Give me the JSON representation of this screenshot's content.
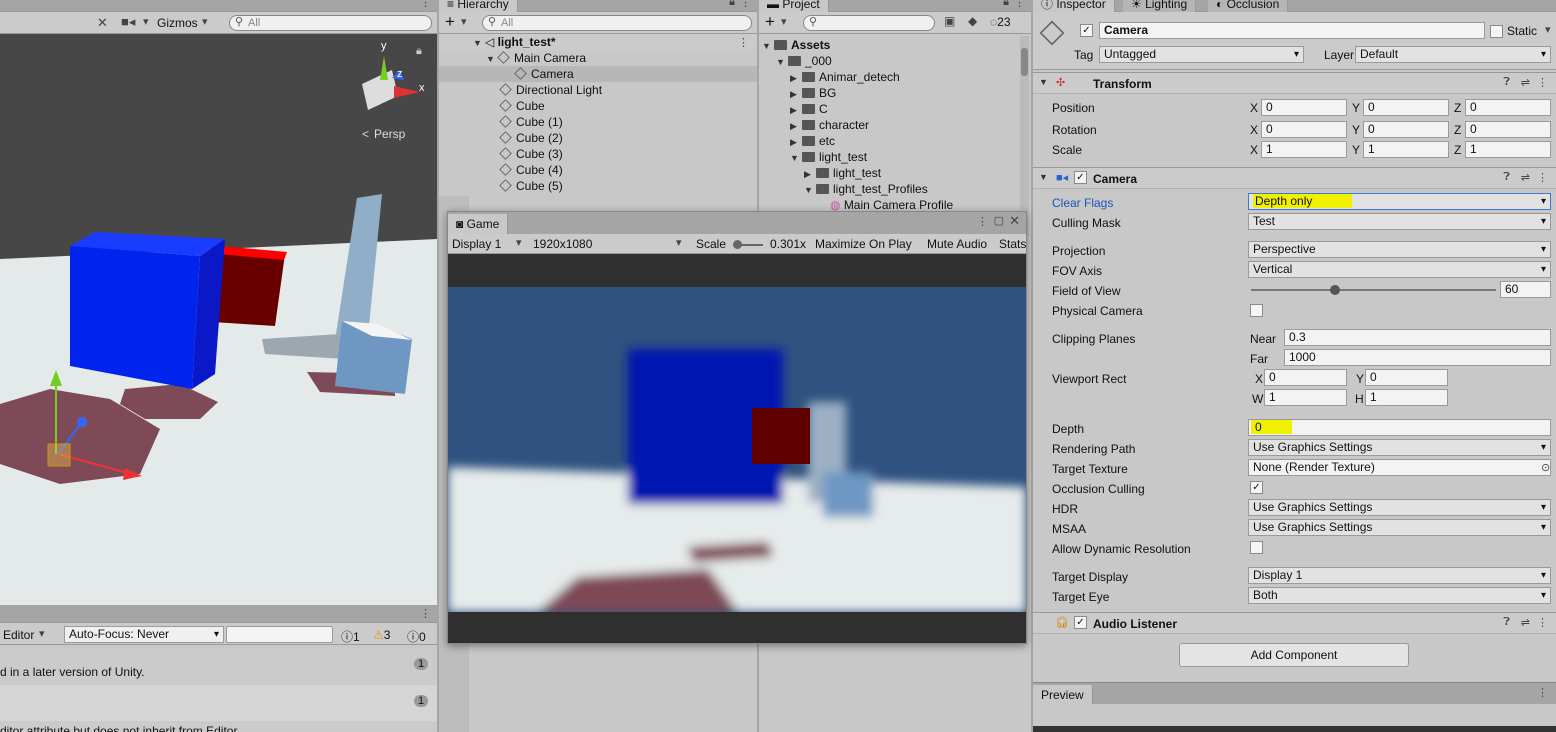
{
  "scene": {
    "toolbar": {
      "gizmos_label": "Gizmos",
      "search_placeholder": "All"
    },
    "view_mode": "Persp",
    "axes": {
      "x": "x",
      "y": "y",
      "z": "z"
    },
    "console": {
      "editor_label": "Editor",
      "autofocus_label": "Auto-Focus: Never",
      "counts": {
        "info": "1",
        "warn": "3",
        "error": "0"
      },
      "rows": [
        {
          "text": "d in a later version of Unity.",
          "count": "1"
        },
        {
          "text": "",
          "count": "1"
        },
        {
          "text": "ditor attribute but does not inherit from Editor",
          "count": ""
        }
      ]
    }
  },
  "hierarchy": {
    "tab_label": "Hierarchy",
    "search_placeholder": "All",
    "add_label": "+",
    "scene_name": "light_test*",
    "items": [
      "Main Camera",
      "Camera",
      "Directional Light",
      "Cube",
      "Cube (1)",
      "Cube (2)",
      "Cube (3)",
      "Cube (4)",
      "Cube (5)"
    ]
  },
  "project": {
    "tab_label": "Project",
    "hidden_count": "23",
    "items": [
      "Assets",
      "_000",
      "Animar_detech",
      "BG",
      "C",
      "character",
      "etc",
      "light_test",
      "light_test",
      "light_test_Profiles",
      "Main Camera Profile"
    ]
  },
  "game": {
    "tab_label": "Game",
    "display": "Display 1",
    "resolution": "1920x1080",
    "scale_label": "Scale",
    "scale_value": "0.301x",
    "maximize": "Maximize On Play",
    "mute": "Mute Audio",
    "stats": "Stats"
  },
  "inspector": {
    "tabs": [
      "Inspector",
      "Lighting",
      "Occlusion"
    ],
    "object_name": "Camera",
    "static_label": "Static",
    "tag_label": "Tag",
    "tag_value": "Untagged",
    "layer_label": "Layer",
    "layer_value": "Default",
    "transform": {
      "title": "Transform",
      "rows": [
        {
          "label": "Position",
          "x": "0",
          "y": "0",
          "z": "0"
        },
        {
          "label": "Rotation",
          "x": "0",
          "y": "0",
          "z": "0"
        },
        {
          "label": "Scale",
          "x": "1",
          "y": "1",
          "z": "1"
        }
      ]
    },
    "camera": {
      "title": "Camera",
      "clear_flags": {
        "label": "Clear Flags",
        "value": "Depth only"
      },
      "culling_mask": {
        "label": "Culling Mask",
        "value": "Test"
      },
      "projection": {
        "label": "Projection",
        "value": "Perspective"
      },
      "fov_axis": {
        "label": "FOV Axis",
        "value": "Vertical"
      },
      "fov": {
        "label": "Field of View",
        "value": "60"
      },
      "physical": {
        "label": "Physical Camera"
      },
      "clipping": {
        "label": "Clipping Planes",
        "near_label": "Near",
        "near": "0.3",
        "far_label": "Far",
        "far": "1000"
      },
      "viewport": {
        "label": "Viewport Rect",
        "x": "0",
        "y": "0",
        "w": "1",
        "h": "1"
      },
      "depth": {
        "label": "Depth",
        "value": "0"
      },
      "rendering_path": {
        "label": "Rendering Path",
        "value": "Use Graphics Settings"
      },
      "target_texture": {
        "label": "Target Texture",
        "value": "None (Render Texture)"
      },
      "occlusion": {
        "label": "Occlusion Culling"
      },
      "hdr": {
        "label": "HDR",
        "value": "Use Graphics Settings"
      },
      "msaa": {
        "label": "MSAA",
        "value": "Use Graphics Settings"
      },
      "dynres": {
        "label": "Allow Dynamic Resolution"
      },
      "target_display": {
        "label": "Target Display",
        "value": "Display 1"
      },
      "target_eye": {
        "label": "Target Eye",
        "value": "Both"
      }
    },
    "audio_listener": "Audio Listener",
    "add_component": "Add Component",
    "preview": "Preview"
  }
}
